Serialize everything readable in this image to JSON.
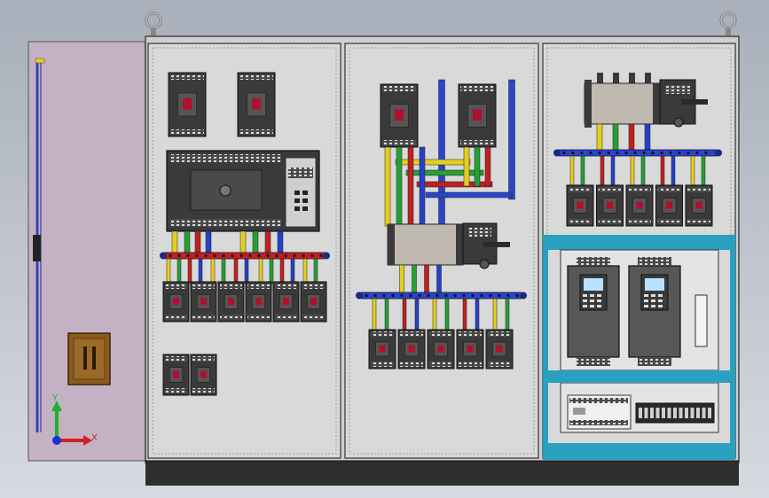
{
  "colors": {
    "background_top": "#aab1bc",
    "background_bottom": "#d3d7de",
    "door": "#c4b2c4",
    "panel": "#d9d9d9",
    "plinth": "#2e2e2e",
    "busbar_blue": "#2b45c9",
    "busbar_red": "#c81e1e",
    "wire_yellow": "#e3cf1e",
    "wire_green": "#25a035",
    "wire_red": "#c02020",
    "wire_blue": "#2440c8",
    "teal_frame": "#2aa0c0",
    "lever_brown": "#8a5a1e"
  },
  "triad": {
    "y_label": "Y",
    "x_label": "X"
  },
  "icons": {
    "lifting_eye_left": "lifting-eye-icon",
    "lifting_eye_right": "lifting-eye-icon",
    "axis_triad": "coordinate-triad-icon"
  }
}
